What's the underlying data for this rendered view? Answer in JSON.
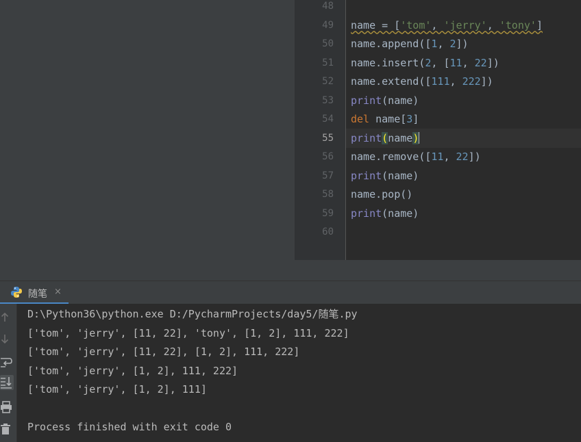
{
  "editor": {
    "current_line": "55",
    "lines": [
      {
        "num": "48",
        "tokens": []
      },
      {
        "num": "49",
        "tokens": [
          {
            "t": "name",
            "c": "tok-warn"
          },
          {
            "t": " = ",
            "c": "tok-warn"
          },
          {
            "t": "[",
            "c": "tok-warn"
          },
          {
            "t": "'tom'",
            "c": "tok-str tok-warn"
          },
          {
            "t": ", ",
            "c": "tok-warn"
          },
          {
            "t": "'jerry'",
            "c": "tok-str tok-warn"
          },
          {
            "t": ", ",
            "c": "tok-warn"
          },
          {
            "t": "'tony'",
            "c": "tok-str tok-warn"
          },
          {
            "t": "]",
            "c": "tok-warn"
          }
        ]
      },
      {
        "num": "50",
        "tokens": [
          {
            "t": "name.append([",
            "c": ""
          },
          {
            "t": "1",
            "c": "tok-num"
          },
          {
            "t": ", ",
            "c": ""
          },
          {
            "t": "2",
            "c": "tok-num"
          },
          {
            "t": "])",
            "c": ""
          }
        ]
      },
      {
        "num": "51",
        "tokens": [
          {
            "t": "name.insert(",
            "c": ""
          },
          {
            "t": "2",
            "c": "tok-num"
          },
          {
            "t": ", [",
            "c": ""
          },
          {
            "t": "11",
            "c": "tok-num"
          },
          {
            "t": ", ",
            "c": ""
          },
          {
            "t": "22",
            "c": "tok-num"
          },
          {
            "t": "])",
            "c": ""
          }
        ]
      },
      {
        "num": "52",
        "tokens": [
          {
            "t": "name.extend([",
            "c": ""
          },
          {
            "t": "111",
            "c": "tok-num"
          },
          {
            "t": ", ",
            "c": ""
          },
          {
            "t": "222",
            "c": "tok-num"
          },
          {
            "t": "])",
            "c": ""
          }
        ]
      },
      {
        "num": "53",
        "tokens": [
          {
            "t": "print",
            "c": "tok-fn"
          },
          {
            "t": "(name)",
            "c": ""
          }
        ]
      },
      {
        "num": "54",
        "tokens": [
          {
            "t": "del",
            "c": "tok-kw"
          },
          {
            "t": " name[",
            "c": ""
          },
          {
            "t": "3",
            "c": "tok-num"
          },
          {
            "t": "]",
            "c": ""
          }
        ]
      },
      {
        "num": "55",
        "tokens": [
          {
            "t": "print",
            "c": "tok-fn"
          },
          {
            "t": "(",
            "c": "brace-match"
          },
          {
            "t": "name",
            "c": ""
          },
          {
            "t": ")",
            "c": "brace-match"
          },
          {
            "t": "",
            "c": "caret"
          }
        ]
      },
      {
        "num": "56",
        "tokens": [
          {
            "t": "name.remove([",
            "c": ""
          },
          {
            "t": "11",
            "c": "tok-num"
          },
          {
            "t": ", ",
            "c": ""
          },
          {
            "t": "22",
            "c": "tok-num"
          },
          {
            "t": "])",
            "c": ""
          }
        ]
      },
      {
        "num": "57",
        "tokens": [
          {
            "t": "print",
            "c": "tok-fn"
          },
          {
            "t": "(name)",
            "c": ""
          }
        ]
      },
      {
        "num": "58",
        "tokens": [
          {
            "t": "name.pop()",
            "c": ""
          }
        ]
      },
      {
        "num": "59",
        "tokens": [
          {
            "t": "print",
            "c": "tok-fn"
          },
          {
            "t": "(name)",
            "c": ""
          }
        ]
      },
      {
        "num": "60",
        "tokens": []
      }
    ]
  },
  "run_panel": {
    "tab_label": "随笔",
    "close_glyph": "×",
    "toolbar_icons": [
      "arrow-up-icon",
      "arrow-down-icon",
      "soft-wrap-icon",
      "scroll-to-end-icon",
      "print-icon",
      "trash-icon"
    ],
    "console_lines": [
      "D:\\Python36\\python.exe D:/PycharmProjects/day5/随笔.py",
      "['tom', 'jerry', [11, 22], 'tony', [1, 2], 111, 222]",
      "['tom', 'jerry', [11, 22], [1, 2], 111, 222]",
      "['tom', 'jerry', [1, 2], 111, 222]",
      "['tom', 'jerry', [1, 2], 111]",
      "",
      "Process finished with exit code 0"
    ]
  },
  "colors": {
    "editor_bg": "#2b2b2b",
    "panel_bg": "#3c3f41",
    "string": "#6a8759",
    "number": "#6897bb",
    "keyword": "#cc7832",
    "builtin": "#8888c6",
    "accent": "#4a88c7"
  }
}
